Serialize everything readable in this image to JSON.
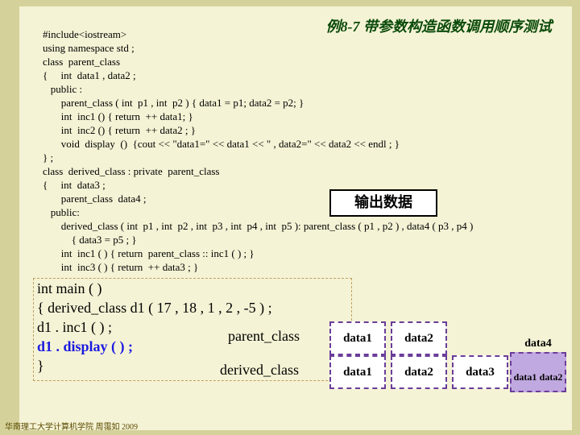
{
  "title": "例8-7  带参数构造函数调用顺序测试",
  "code": {
    "l1": "#include<iostream>",
    "l2": "using namespace std ;",
    "l3": "class  parent_class",
    "l4": "{     int  data1 , data2 ;",
    "l5": "   public :",
    "l6": "       parent_class ( int  p1 , int  p2 ) { data1 = p1; data2 = p2; }",
    "l7": "       int  inc1 () { return  ++ data1; }",
    "l8": "       int  inc2 () { return  ++ data2 ; }",
    "l9": "       void  display  ()  {cout << \"data1=\" << data1 << \" , data2=\" << data2 << endl ; }",
    "l10": "} ;",
    "l11": "class  derived_class : private  parent_class",
    "l12": "{     int  data3 ;",
    "l13": "       parent_class  data4 ;",
    "l14": "   public:",
    "l15": "       derived_class ( int  p1 , int  p2 , int  p3 , int  p4 , int  p5 ): parent_class ( p1 , p2 ) , data4 ( p3 , p4 )",
    "l16": "           { data3 = p5 ; }",
    "l17": "       int  inc1 ( ) { return  parent_class :: inc1 ( ) ; }",
    "l18": "       int  inc3 ( ) { return  ++ data3 ; }"
  },
  "output_label": "输出数据",
  "main": {
    "l1": "int main ( )",
    "l2": "{ derived_class  d1 ( 17 , 18 , 1 , 2 , -5 ) ;",
    "l3": "    d1 . inc1 ( ) ;",
    "l4": "    d1 . display ( ) ;",
    "l5": "}"
  },
  "labels": {
    "parent": "parent_class",
    "derived": "derived_class"
  },
  "boxes": {
    "d1": "data1",
    "d2": "data2",
    "d3": "data3",
    "d4": "data4",
    "d4a": "data1",
    "d4b": "data2"
  },
  "footer": "华南理工大学计算机学院 周霭如 2009"
}
